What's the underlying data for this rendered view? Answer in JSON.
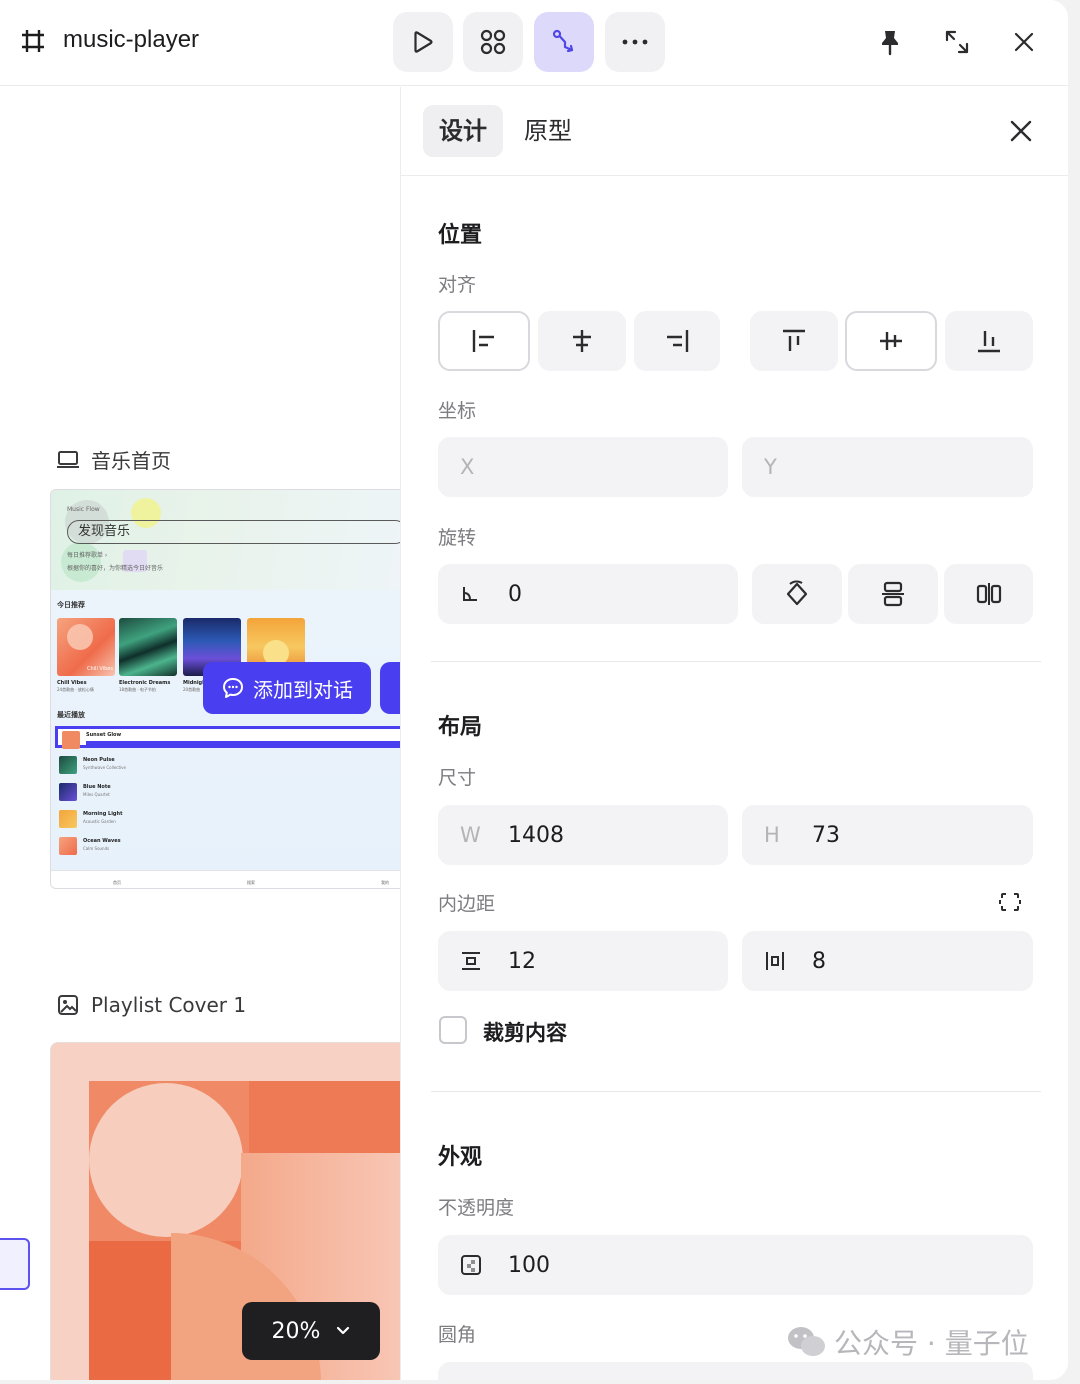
{
  "header": {
    "title": "music-player",
    "icons": [
      "frame-icon",
      "play-icon",
      "components-icon",
      "prototype-icon",
      "more-icon",
      "pin-icon",
      "expand-icon",
      "close-icon"
    ]
  },
  "canvas": {
    "frame1_label": "音乐首页",
    "frame2_label": "Playlist Cover 1",
    "zoom": "20%",
    "add_to_chat": "添加到对话",
    "preview": {
      "app_name": "Music Flow",
      "search": "发现音乐",
      "line1": "每日推荐歌单 ›",
      "line2": "根据你的喜好，为你精选今日好音乐",
      "today_section": "今日推荐",
      "recent_section": "最近播放",
      "covers": [
        {
          "title": "Chill Vibes",
          "sub": "24首歌曲 · 放松心情"
        },
        {
          "title": "Electronic Dreams",
          "sub": "18首歌曲 · 电子节拍"
        },
        {
          "title": "Midnight",
          "sub": "20首歌曲"
        },
        {
          "title": "",
          "sub": ""
        }
      ],
      "cover_badge": "Chill Vibes",
      "recent": [
        {
          "title": "Sunset Glow",
          "artist": ""
        },
        {
          "title": "Neon Pulse",
          "artist": "Synthwave Collective"
        },
        {
          "title": "Blue Note",
          "artist": "Miles Quartet"
        },
        {
          "title": "Morning Light",
          "artist": "Acoustic Garden"
        },
        {
          "title": "Ocean Waves",
          "artist": "Calm Sounds"
        }
      ],
      "nav": [
        "首页",
        "搜索",
        "我的"
      ]
    }
  },
  "panel": {
    "tabs": [
      "设计",
      "原型"
    ],
    "position": {
      "title": "位置",
      "align_label": "对齐",
      "coord_label": "坐标",
      "x_placeholder": "X",
      "y_placeholder": "Y",
      "rotation_label": "旋转",
      "rotation_value": "0"
    },
    "layout": {
      "title": "布局",
      "size_label": "尺寸",
      "w_label": "W",
      "w_value": "1408",
      "h_label": "H",
      "h_value": "73",
      "padding_label": "内边距",
      "padding_v": "12",
      "padding_h": "8",
      "clip_label": "裁剪内容"
    },
    "appearance": {
      "title": "外观",
      "opacity_label": "不透明度",
      "opacity_value": "100",
      "radius_label": "圆角"
    }
  },
  "watermark": "公众号 · 量子位",
  "colors": {
    "accent": "#4a3ff0",
    "active_tool": "#dcd9fb",
    "field_bg": "#f3f3f5"
  }
}
